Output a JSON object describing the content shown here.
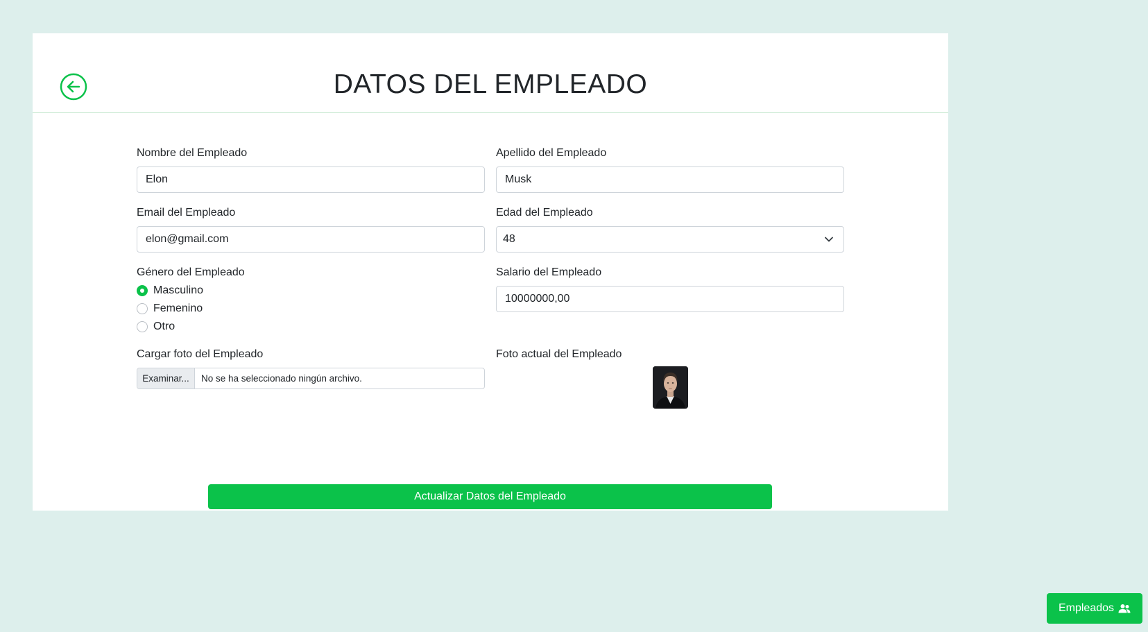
{
  "header": {
    "title": "DATOS DEL EMPLEADO",
    "back_icon": "arrow-left-circle-icon"
  },
  "form": {
    "first_name": {
      "label": "Nombre del Empleado",
      "value": "Elon"
    },
    "last_name": {
      "label": "Apellido del Empleado",
      "value": "Musk"
    },
    "email": {
      "label": "Email del Empleado",
      "value": "elon@gmail.com"
    },
    "age": {
      "label": "Edad del Empleado",
      "value": "48"
    },
    "gender": {
      "label": "Género del Empleado",
      "options": [
        "Masculino",
        "Femenino",
        "Otro"
      ],
      "selected": "Masculino"
    },
    "salary": {
      "label": "Salario del Empleado",
      "value": "10000000,00"
    },
    "upload_photo": {
      "label": "Cargar foto del Empleado",
      "button": "Examinar...",
      "status": "No se ha seleccionado ningún archivo."
    },
    "current_photo": {
      "label": "Foto actual del Empleado"
    },
    "submit_label": "Actualizar Datos del Empleado"
  },
  "floating": {
    "label": "Empleados",
    "icon": "users-icon"
  },
  "colors": {
    "accent": "#0bc24a",
    "background": "#ddefec"
  }
}
